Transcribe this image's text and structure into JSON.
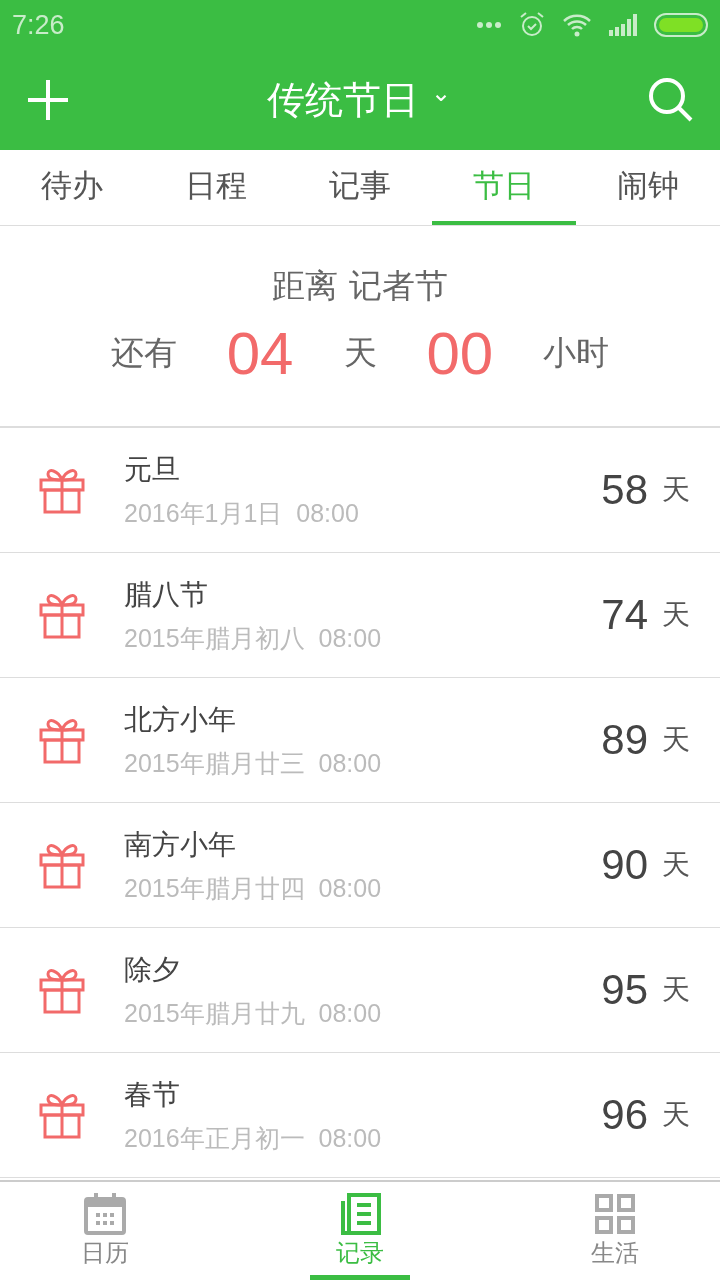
{
  "status_bar": {
    "time": "7:26"
  },
  "header": {
    "title": "传统节日",
    "dropdown": "⌄"
  },
  "tabs": [
    {
      "label": "待办",
      "selected": false
    },
    {
      "label": "日程",
      "selected": false
    },
    {
      "label": "记事",
      "selected": false
    },
    {
      "label": "节日",
      "selected": true
    },
    {
      "label": "闹钟",
      "selected": false
    }
  ],
  "countdown": {
    "heading": "距离 记者节",
    "prefix": "还有",
    "days": "04",
    "days_unit": "天",
    "hours": "00",
    "hours_unit": "小时"
  },
  "festivals": [
    {
      "name": "元旦",
      "date": "2016年1月1日  08:00",
      "days": "58",
      "unit": "天"
    },
    {
      "name": "腊八节",
      "date": "2015年腊月初八  08:00",
      "days": "74",
      "unit": "天"
    },
    {
      "name": "北方小年",
      "date": "2015年腊月廿三  08:00",
      "days": "89",
      "unit": "天"
    },
    {
      "name": "南方小年",
      "date": "2015年腊月廿四  08:00",
      "days": "90",
      "unit": "天"
    },
    {
      "name": "除夕",
      "date": "2015年腊月廿九  08:00",
      "days": "95",
      "unit": "天"
    },
    {
      "name": "春节",
      "date": "2016年正月初一  08:00",
      "days": "96",
      "unit": "天"
    }
  ],
  "bottom_nav": [
    {
      "label": "日历",
      "kind": "calendar",
      "selected": false
    },
    {
      "label": "记录",
      "kind": "notes",
      "selected": true
    },
    {
      "label": "生活",
      "kind": "grid",
      "selected": false
    }
  ]
}
